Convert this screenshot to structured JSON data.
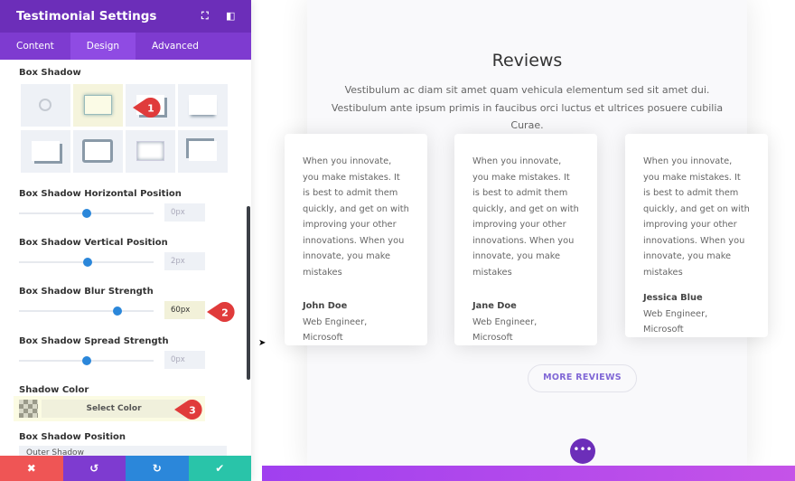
{
  "panel": {
    "title": "Testimonial Settings",
    "icons": [
      "expand-icon",
      "sidebar-toggle-icon"
    ],
    "tabs": [
      {
        "label": "Content",
        "active": false
      },
      {
        "label": "Design",
        "active": true
      },
      {
        "label": "Advanced",
        "active": false
      }
    ],
    "box_shadow_label": "Box Shadow",
    "presets_selected": 1,
    "fields": [
      {
        "label": "Box Shadow Horizontal Position",
        "value": "0px",
        "level": 0.5
      },
      {
        "label": "Box Shadow Vertical Position",
        "value": "2px",
        "level": 0.51
      },
      {
        "label": "Box Shadow Blur Strength",
        "value": "60px",
        "level": 0.73
      },
      {
        "label": "Box Shadow Spread Strength",
        "value": "0px",
        "level": 0.5
      }
    ],
    "shadow_color_label": "Shadow Color",
    "select_color": "Select Color",
    "position_label": "Box Shadow Position",
    "position_value": "Outer Shadow",
    "markers": [
      "1",
      "2",
      "3"
    ],
    "footer": {
      "cancel": "✖",
      "undo": "↺",
      "redo": "↻",
      "save": "✔"
    },
    "colors": {
      "header": "#6c2eb9",
      "tabs": "#7e3bd0",
      "cancel": "#ef5555",
      "undo": "#7e3bd0",
      "redo": "#2b87da",
      "save": "#29c4a9",
      "marker": "#e03b3b",
      "slider": "#2b87da"
    }
  },
  "page": {
    "title": "Reviews",
    "subtitle": "Vestibulum ac diam sit amet quam vehicula elementum sed sit amet dui. Vestibulum ante ipsum primis in faucibus orci luctus et ultrices posuere cubilia Curae.",
    "testimonials": [
      {
        "quote": "When you innovate, you make mistakes. It is best to admit them quickly, and get on with improving your other innovations. When you innovate, you make mistakes",
        "name": "John Doe",
        "role": "Web Engineer, Microsoft"
      },
      {
        "quote": "When you innovate, you make mistakes. It is best to admit them quickly, and get on with improving your other innovations. When you innovate, you make mistakes",
        "name": "Jane Doe",
        "role": "Web Engineer, Microsoft"
      },
      {
        "quote": "When you innovate, you make mistakes. It is best to admit them quickly, and get on with improving your other innovations. When you innovate, you make mistakes",
        "name": "Jessica Blue",
        "role": "Web Engineer, Microsoft"
      }
    ],
    "button": "MORE REVIEWS",
    "more_icon": "•••"
  }
}
